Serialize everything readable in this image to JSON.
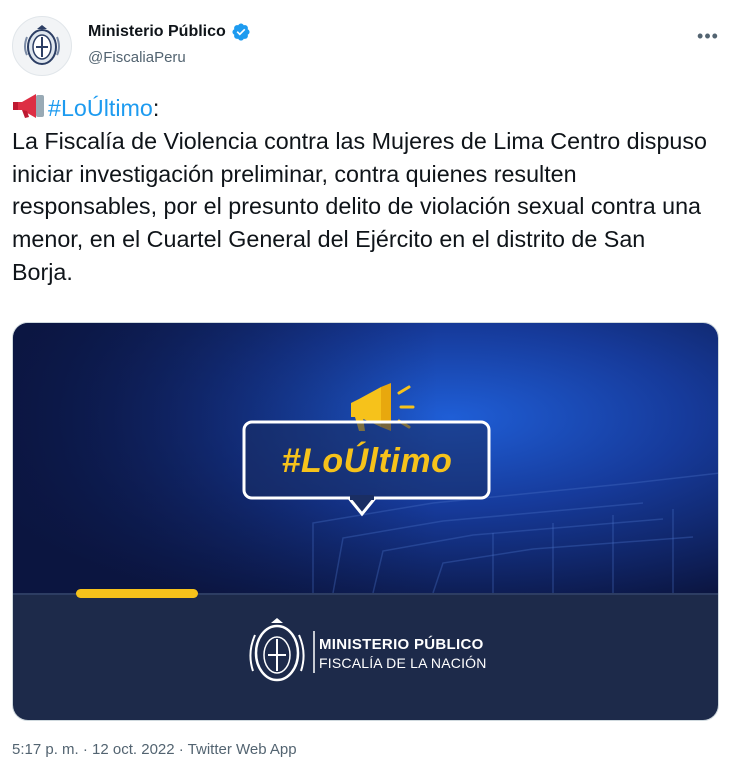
{
  "tweet": {
    "author_name": "Ministerio Público",
    "author_handle": "@FiscaliaPeru",
    "hashtag": "#LoÚltimo",
    "hashtag_suffix": ":",
    "body": "La Fiscalía de Violencia contra las Mujeres de Lima Centro dispuso iniciar investigación preliminar, contra quienes resulten responsables, por el presunto delito de violación sexual contra una menor, en el Cuartel General del Ejército en el distrito de San Borja.",
    "emoji": "megaphone-icon",
    "timestamp": "5:17 p. m. · 12 oct. 2022 · Twitter Web App"
  },
  "media": {
    "hashtag_text": "#LoÚltimo",
    "logo_title": "MINISTERIO PÚBLICO",
    "logo_subtitle": "FISCALÍA DE LA NACIÓN"
  },
  "colors": {
    "link": "#1d9bf0",
    "verified": "#1d9bf0",
    "media_accent": "#f6c21b",
    "media_dark": "#1d2a4a"
  }
}
